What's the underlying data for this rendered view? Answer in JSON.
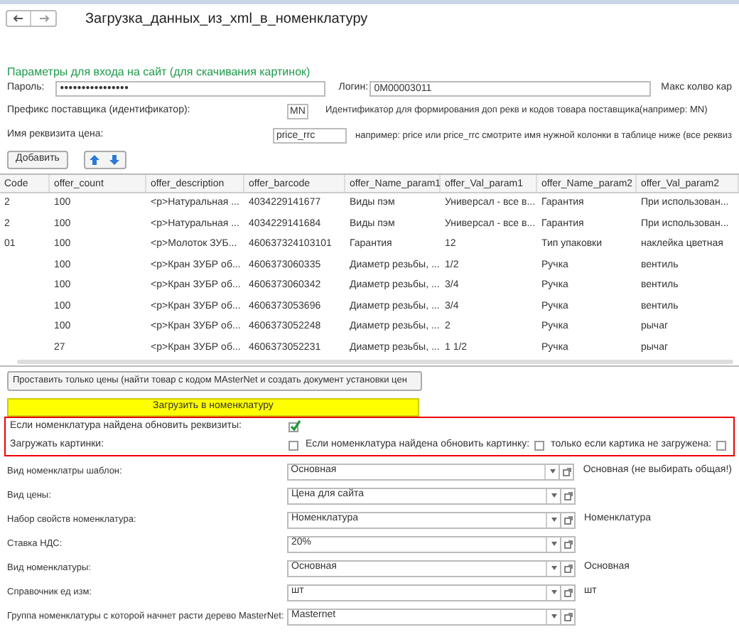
{
  "window": {
    "title": "Загрузка_данных_из_xml_в_номенклатуру"
  },
  "login_section": {
    "heading": "Параметры для входа на сайт (для скачивания картинок)",
    "password_label": "Пароль:",
    "password_value": "●●●●●●●●●●●●●●●●",
    "login_label": "Логин:",
    "login_value": "0M00003011",
    "max_label": "Макс колво кар"
  },
  "prefix": {
    "label": "Префикс поставщика (идентификатор):",
    "value": "MN",
    "hint": "Идентификатор для формирования доп рекв и кодов товара поставщика(например: MN)"
  },
  "price_attr": {
    "label": "Имя реквизита цена:",
    "value": "price_rrc",
    "hint": "например: price или price_rrc смотрите имя нужной колонки в таблице ниже (все реквиз"
  },
  "toolbar": {
    "add_button": "Добавить"
  },
  "table": {
    "columns": [
      "Code",
      "offer_count",
      "offer_description",
      "offer_barcode",
      "offer_Name_param1",
      "offer_Val_param1",
      "offer_Name_param2",
      "offer_Val_param2"
    ],
    "rows": [
      [
        "2",
        "100",
        "<p>Натуральная ...",
        "4034229141677",
        "Виды пэм",
        "Универсал - все в...",
        "Гарантия",
        "При использован..."
      ],
      [
        "2",
        "100",
        "<p>Натуральная ...",
        "4034229141684",
        "Виды пэм",
        "Универсал - все в...",
        "Гарантия",
        "При использован..."
      ],
      [
        "01",
        "100",
        "<p>Молоток ЗУБ...",
        "460637324103101",
        "Гарантия",
        "12",
        "Тип упаковки",
        "наклейка цветная"
      ],
      [
        null,
        "100",
        "<p>Кран ЗУБР об...",
        "4606373060335",
        "Диаметр резьбы, ...",
        "1/2",
        "Ручка",
        "вентиль"
      ],
      [
        null,
        "100",
        "<p>Кран ЗУБР об...",
        "4606373060342",
        "Диаметр резьбы, ...",
        "3/4",
        "Ручка",
        "вентиль"
      ],
      [
        null,
        "100",
        "<p>Кран ЗУБР об...",
        "4606373053696",
        "Диаметр резьбы, ...",
        "3/4",
        "Ручка",
        "вентиль"
      ],
      [
        null,
        "100",
        "<p>Кран ЗУБР об...",
        "4606373052248",
        "Диаметр резьбы, ...",
        "2",
        "Ручка",
        "рычаг"
      ],
      [
        null,
        "27",
        "<p>Кран ЗУБР об...",
        "4606373052231",
        "Диаметр резьбы, ...",
        "1 1/2",
        "Ручка",
        "рычаг"
      ]
    ]
  },
  "prices_button": "Проставить только цены (найти товар с кодом MAsterNet и создать документ установки цен",
  "load_button": "Загрузить в номенклатуру",
  "options": [
    {
      "label": "Если номенклатура найдена обновить реквизиты:",
      "checks": [
        {
          "checked": true
        }
      ]
    },
    {
      "label": "Загружать картинки:",
      "checks": [
        {
          "checked": false
        },
        {
          "label": "Если номенклатура найдена обновить картинку:",
          "checked": false
        },
        {
          "label": "только если картика не загружена:",
          "checked": false
        }
      ]
    }
  ],
  "fields": [
    {
      "label": "Вид номенклатры шаблон:",
      "value": "Основная",
      "note": "Основная (не выбирать общая!)"
    },
    {
      "label": "Вид цены:",
      "value": "Цена для сайта"
    },
    {
      "label": "Набор свойств номенклатура:",
      "value": "Номенклатура",
      "note": "Номенклатура"
    },
    {
      "label": "Ставка НДС:",
      "value": "20%"
    },
    {
      "label": "Вид номенклатуры:",
      "value": "Основная",
      "note": "Основная"
    },
    {
      "label": "Справочник ед изм:",
      "value": "шт",
      "note": "шт"
    },
    {
      "label": "Группа номенклатуры с которой начнет расти дерево MasterNet:",
      "value": "Masternet"
    }
  ]
}
